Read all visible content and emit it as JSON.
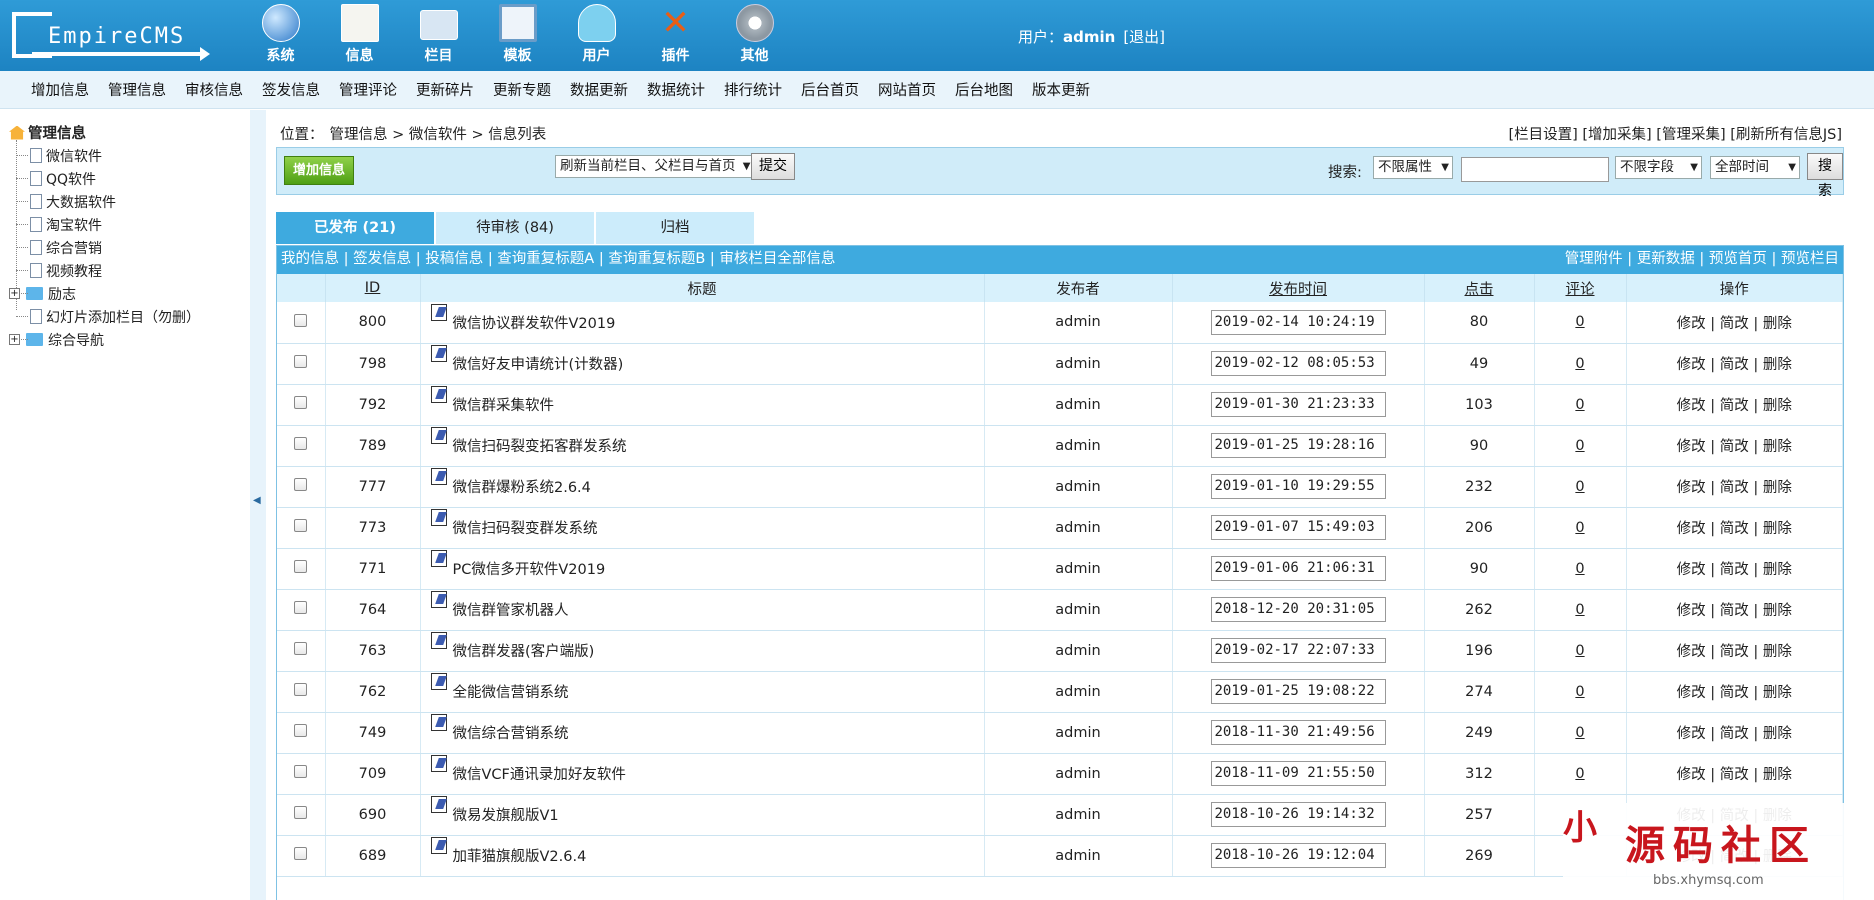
{
  "header": {
    "logo_text": "EmpireCMS",
    "modules": [
      "系统",
      "信息",
      "栏目",
      "模板",
      "用户",
      "插件",
      "其他"
    ],
    "user_label": "用户：",
    "user_name": "admin",
    "logout": "[退出]"
  },
  "menu": [
    "增加信息",
    "管理信息",
    "审核信息",
    "签发信息",
    "管理评论",
    "更新碎片",
    "更新专题",
    "数据更新",
    "数据统计",
    "排行统计",
    "后台首页",
    "网站首页",
    "后台地图",
    "版本更新"
  ],
  "sidebar": {
    "root": "管理信息",
    "items": [
      "微信软件",
      "QQ软件",
      "大数据软件",
      "淘宝软件",
      "综合营销",
      "视频教程"
    ],
    "folders": [
      "励志",
      "幻灯片添加栏目（勿删）",
      "综合导航"
    ]
  },
  "location": {
    "label": "位置：",
    "path": "管理信息 > 微信软件 > 信息列表"
  },
  "top_links": "[栏目设置] [增加采集] [管理采集] [刷新所有信息JS]",
  "toolbar": {
    "add_button": "增加信息",
    "refresh_select": "刷新当前栏目、父栏目与首页",
    "submit": "提交",
    "search_label": "搜索:",
    "attr_select": "不限属性",
    "field_select": "不限字段",
    "time_select": "全部时间",
    "search_button": "搜索"
  },
  "tabs": [
    "已发布 (21)",
    "待审核 (84)",
    "归档"
  ],
  "subbar": {
    "left": "我的信息 | 签发信息 | 投稿信息 | 查询重复标题A | 查询重复标题B | 审核栏目全部信息",
    "right": "管理附件 | 更新数据 | 预览首页 | 预览栏目"
  },
  "table": {
    "headers": [
      "",
      "ID",
      "标题",
      "发布者",
      "发布时间",
      "点击",
      "评论",
      "操作"
    ],
    "action_text": "修改 | 简改 | 删除",
    "rows": [
      {
        "id": "800",
        "title": "微信协议群发软件V2019",
        "author": "admin",
        "time": "2019-02-14 10:24:19",
        "clicks": "80",
        "comments": "0"
      },
      {
        "id": "798",
        "title": "微信好友申请统计(计数器)",
        "author": "admin",
        "time": "2019-02-12 08:05:53",
        "clicks": "49",
        "comments": "0"
      },
      {
        "id": "792",
        "title": "微信群采集软件",
        "author": "admin",
        "time": "2019-01-30 21:23:33",
        "clicks": "103",
        "comments": "0"
      },
      {
        "id": "789",
        "title": "微信扫码裂变拓客群发系统",
        "author": "admin",
        "time": "2019-01-25 19:28:16",
        "clicks": "90",
        "comments": "0"
      },
      {
        "id": "777",
        "title": "微信群爆粉系统2.6.4",
        "author": "admin",
        "time": "2019-01-10 19:29:55",
        "clicks": "232",
        "comments": "0"
      },
      {
        "id": "773",
        "title": "微信扫码裂变群发系统",
        "author": "admin",
        "time": "2019-01-07 15:49:03",
        "clicks": "206",
        "comments": "0"
      },
      {
        "id": "771",
        "title": "PC微信多开软件V2019",
        "author": "admin",
        "time": "2019-01-06 21:06:31",
        "clicks": "90",
        "comments": "0"
      },
      {
        "id": "764",
        "title": "微信群管家机器人",
        "author": "admin",
        "time": "2018-12-20 20:31:05",
        "clicks": "262",
        "comments": "0"
      },
      {
        "id": "763",
        "title": "微信群发器(客户端版)",
        "author": "admin",
        "time": "2019-02-17 22:07:33",
        "clicks": "196",
        "comments": "0"
      },
      {
        "id": "762",
        "title": "全能微信营销系统",
        "author": "admin",
        "time": "2019-01-25 19:08:22",
        "clicks": "274",
        "comments": "0"
      },
      {
        "id": "749",
        "title": "微信综合营销系统",
        "author": "admin",
        "time": "2018-11-30 21:49:56",
        "clicks": "249",
        "comments": "0"
      },
      {
        "id": "709",
        "title": "微信VCF通讯录加好友软件",
        "author": "admin",
        "time": "2018-11-09 21:55:50",
        "clicks": "312",
        "comments": "0"
      },
      {
        "id": "690",
        "title": "微易发旗舰版V1",
        "author": "admin",
        "time": "2018-10-26 19:14:32",
        "clicks": "257",
        "comments": ""
      },
      {
        "id": "689",
        "title": "加菲猫旗舰版V2.6.4",
        "author": "admin",
        "time": "2018-10-26 19:12:04",
        "clicks": "269",
        "comments": ""
      }
    ]
  },
  "watermark": {
    "seal": "小",
    "site": "源码社区",
    "url": "bbs.xhymsq.com"
  }
}
